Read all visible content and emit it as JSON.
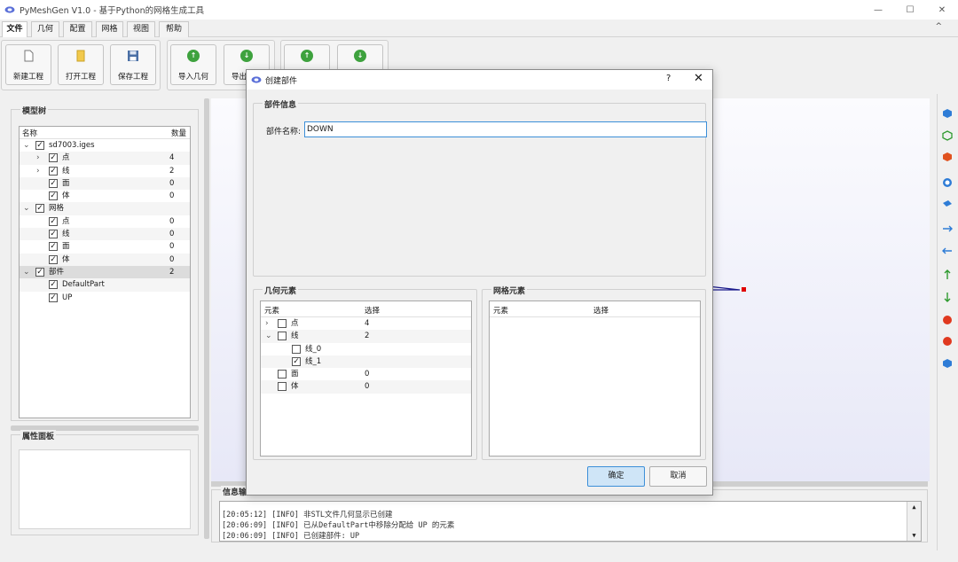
{
  "window": {
    "title": "PyMeshGen V1.0 - 基于Python的网格生成工具",
    "minimize": "—",
    "maximize": "☐",
    "close": "✕"
  },
  "menu": {
    "tabs": [
      "文件",
      "几何",
      "配置",
      "网格",
      "视图",
      "帮助"
    ],
    "active": "文件",
    "collapse": "^"
  },
  "ribbon": {
    "new_project": "新建工程",
    "open_project": "打开工程",
    "save_project": "保存工程",
    "import_geometry": "导入几何",
    "export": "导出"
  },
  "model_tree": {
    "title": "模型树",
    "col_name": "名称",
    "col_count": "数量",
    "rows": [
      {
        "name": "sd7003.iges",
        "count": "",
        "level": 0,
        "arrow": "v",
        "checked": true
      },
      {
        "name": "点",
        "count": "4",
        "level": 1,
        "arrow": ">",
        "checked": true
      },
      {
        "name": "线",
        "count": "2",
        "level": 1,
        "arrow": ">",
        "checked": true
      },
      {
        "name": "面",
        "count": "0",
        "level": 1,
        "arrow": "",
        "checked": true
      },
      {
        "name": "体",
        "count": "0",
        "level": 1,
        "arrow": "",
        "checked": true
      },
      {
        "name": "网格",
        "count": "",
        "level": 0,
        "arrow": "v",
        "checked": true
      },
      {
        "name": "点",
        "count": "0",
        "level": 1,
        "arrow": "",
        "checked": true
      },
      {
        "name": "线",
        "count": "0",
        "level": 1,
        "arrow": "",
        "checked": true
      },
      {
        "name": "面",
        "count": "0",
        "level": 1,
        "arrow": "",
        "checked": true
      },
      {
        "name": "体",
        "count": "0",
        "level": 1,
        "arrow": "",
        "checked": true
      },
      {
        "name": "部件",
        "count": "2",
        "level": 0,
        "arrow": "v",
        "checked": true,
        "selected": true
      },
      {
        "name": "DefaultPart",
        "count": "",
        "level": 1,
        "arrow": "",
        "checked": true
      },
      {
        "name": "UP",
        "count": "",
        "level": 1,
        "arrow": "",
        "checked": true
      }
    ]
  },
  "properties_panel": {
    "title": "属性面板"
  },
  "log": {
    "title": "信息输出",
    "lines": [
      "[20:05:12] [INFO] 非STL文件几何显示已创建",
      "[20:06:09] [INFO] 已从DefaultPart中移除分配给 UP 的元素",
      "[20:06:09] [INFO] 已创建部件: UP"
    ]
  },
  "dialog": {
    "title": "创建部件",
    "help": "?",
    "close": "✕",
    "part_info_title": "部件信息",
    "part_name_label": "部件名称:",
    "part_name_value": "DOWN",
    "geometry_title": "几何元素",
    "mesh_title": "网格元素",
    "col_element": "元素",
    "col_select": "选择",
    "geometry_rows": [
      {
        "name": "点",
        "count": "4",
        "level": 0,
        "arrow": ">",
        "checked": false
      },
      {
        "name": "线",
        "count": "2",
        "level": 0,
        "arrow": "v",
        "checked": false
      },
      {
        "name": "线_0",
        "count": "",
        "level": 1,
        "arrow": "",
        "checked": false
      },
      {
        "name": "线_1",
        "count": "",
        "level": 1,
        "arrow": "",
        "checked": true
      },
      {
        "name": "面",
        "count": "0",
        "level": 0,
        "arrow": "",
        "checked": false
      },
      {
        "name": "体",
        "count": "0",
        "level": 0,
        "arrow": "",
        "checked": false
      }
    ],
    "ok": "确定",
    "cancel": "取消"
  }
}
